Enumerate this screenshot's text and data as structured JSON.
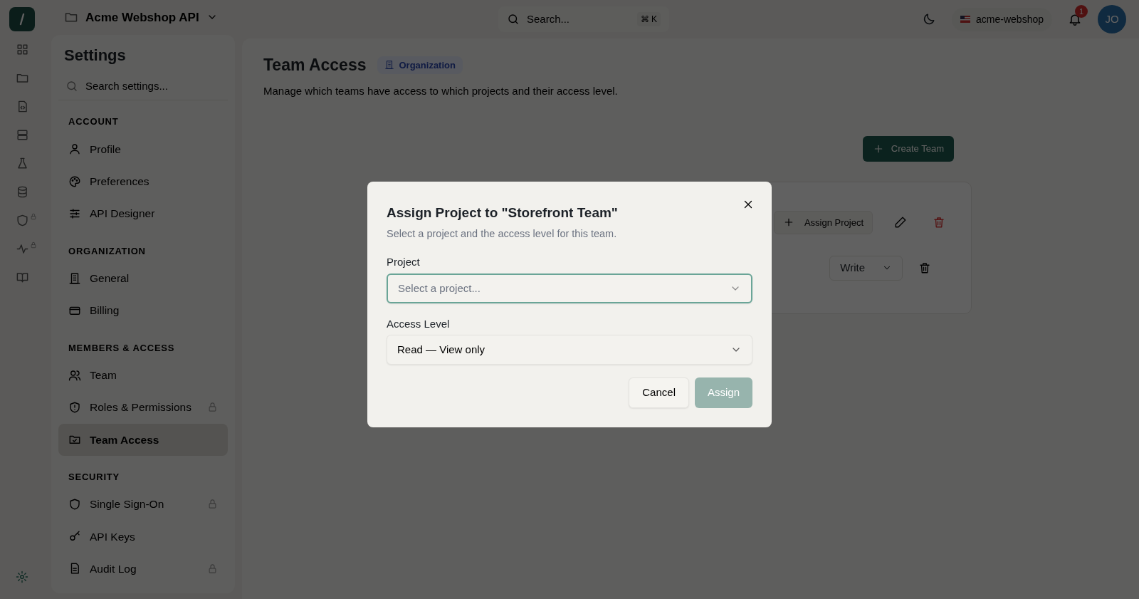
{
  "topbar": {
    "project": "Acme Webshop API",
    "search_placeholder": "Search...",
    "shortcut": "⌘ K",
    "workspace": "acme-webshop",
    "notification_count": "1",
    "avatar": "JO"
  },
  "rail": [
    {
      "locked": false
    },
    {
      "locked": false
    },
    {
      "locked": false
    },
    {
      "locked": false
    },
    {
      "locked": false
    },
    {
      "locked": false
    },
    {
      "locked": true
    },
    {
      "locked": true
    },
    {
      "locked": false
    }
  ],
  "sidebar": {
    "title": "Settings",
    "search_placeholder": "Search settings...",
    "sections": [
      {
        "heading": "ACCOUNT",
        "items": [
          {
            "label": "Profile",
            "locked": false,
            "selected": false
          },
          {
            "label": "Preferences",
            "locked": false,
            "selected": false
          },
          {
            "label": "API Designer",
            "locked": false,
            "selected": false
          }
        ]
      },
      {
        "heading": "ORGANIZATION",
        "items": [
          {
            "label": "General",
            "locked": false,
            "selected": false
          },
          {
            "label": "Billing",
            "locked": false,
            "selected": false
          }
        ]
      },
      {
        "heading": "MEMBERS & ACCESS",
        "items": [
          {
            "label": "Team",
            "locked": false,
            "selected": false
          },
          {
            "label": "Roles & Permissions",
            "locked": true,
            "selected": false
          },
          {
            "label": "Team Access",
            "locked": false,
            "selected": true
          }
        ]
      },
      {
        "heading": "SECURITY",
        "items": [
          {
            "label": "Single Sign-On",
            "locked": true,
            "selected": false
          },
          {
            "label": "API Keys",
            "locked": false,
            "selected": false
          },
          {
            "label": "Audit Log",
            "locked": true,
            "selected": false
          }
        ]
      }
    ]
  },
  "main": {
    "title": "Team Access",
    "badge": "Organization",
    "description": "Manage which teams have access to which projects and their access level.",
    "create_button": "Create Team",
    "assign_button": "Assign Project",
    "access_select": "Write"
  },
  "dialog": {
    "title": "Assign Project to \"Storefront Team\"",
    "subtitle": "Select a project and the access level for this team.",
    "project_label": "Project",
    "project_placeholder": "Select a project...",
    "access_label": "Access Level",
    "access_value": "Read — View only",
    "cancel": "Cancel",
    "assign": "Assign",
    "assign_disabled": true
  }
}
